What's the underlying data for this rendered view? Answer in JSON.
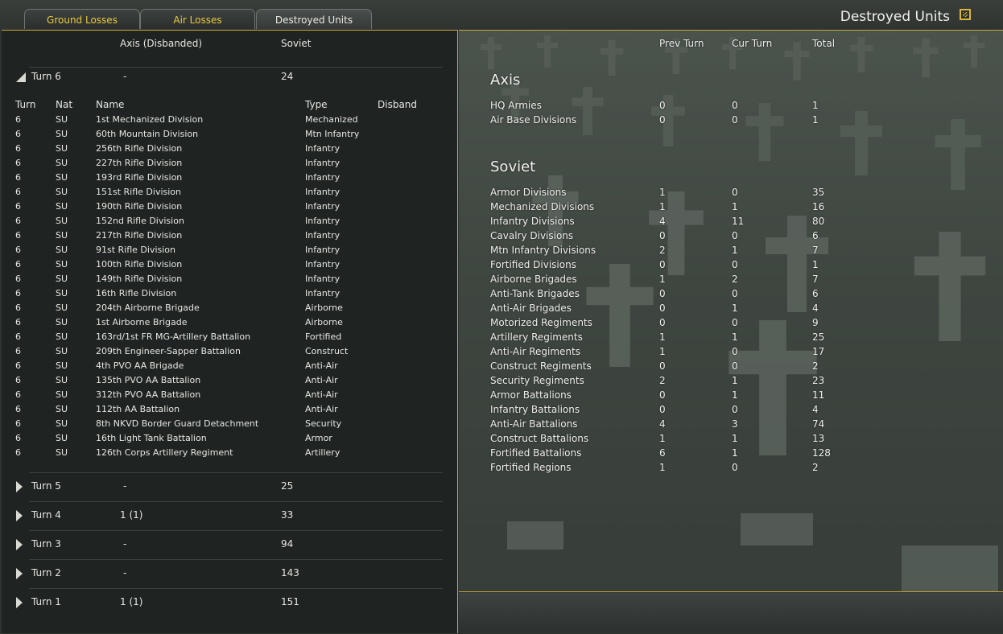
{
  "window": {
    "title": "Destroyed Units"
  },
  "tabs": [
    {
      "label": "Ground Losses",
      "active": false
    },
    {
      "label": "Air Losses",
      "active": false
    },
    {
      "label": "Destroyed Units",
      "active": true
    }
  ],
  "left_panel": {
    "col_axis": "Axis (Disbanded)",
    "col_soviet": "Soviet",
    "expanded_turn": {
      "label": "Turn 6",
      "axis": "-",
      "soviet": "24"
    },
    "unit_headers": {
      "turn": "Turn",
      "nat": "Nat",
      "name": "Name",
      "type": "Type",
      "disband": "Disband"
    },
    "units": [
      {
        "turn": "6",
        "nat": "SU",
        "name": "1st Mechanized Division",
        "type": "Mechanized"
      },
      {
        "turn": "6",
        "nat": "SU",
        "name": "60th Mountain Division",
        "type": "Mtn Infantry"
      },
      {
        "turn": "6",
        "nat": "SU",
        "name": "256th Rifle Division",
        "type": "Infantry"
      },
      {
        "turn": "6",
        "nat": "SU",
        "name": "227th Rifle Division",
        "type": "Infantry"
      },
      {
        "turn": "6",
        "nat": "SU",
        "name": "193rd Rifle Division",
        "type": "Infantry"
      },
      {
        "turn": "6",
        "nat": "SU",
        "name": "151st Rifle Division",
        "type": "Infantry"
      },
      {
        "turn": "6",
        "nat": "SU",
        "name": "190th Rifle Division",
        "type": "Infantry"
      },
      {
        "turn": "6",
        "nat": "SU",
        "name": "152nd Rifle Division",
        "type": "Infantry"
      },
      {
        "turn": "6",
        "nat": "SU",
        "name": "217th Rifle Division",
        "type": "Infantry"
      },
      {
        "turn": "6",
        "nat": "SU",
        "name": "91st Rifle Division",
        "type": "Infantry"
      },
      {
        "turn": "6",
        "nat": "SU",
        "name": "100th Rifle Division",
        "type": "Infantry"
      },
      {
        "turn": "6",
        "nat": "SU",
        "name": "149th Rifle Division",
        "type": "Infantry"
      },
      {
        "turn": "6",
        "nat": "SU",
        "name": "16th Rifle Division",
        "type": "Infantry"
      },
      {
        "turn": "6",
        "nat": "SU",
        "name": "204th Airborne Brigade",
        "type": "Airborne"
      },
      {
        "turn": "6",
        "nat": "SU",
        "name": "1st Airborne Brigade",
        "type": "Airborne"
      },
      {
        "turn": "6",
        "nat": "SU",
        "name": "163rd/1st FR MG-Artillery Battalion",
        "type": "Fortified"
      },
      {
        "turn": "6",
        "nat": "SU",
        "name": "209th Engineer-Sapper Battalion",
        "type": "Construct"
      },
      {
        "turn": "6",
        "nat": "SU",
        "name": "4th PVO AA Brigade",
        "type": "Anti-Air"
      },
      {
        "turn": "6",
        "nat": "SU",
        "name": "135th PVO AA Battalion",
        "type": "Anti-Air"
      },
      {
        "turn": "6",
        "nat": "SU",
        "name": "312th PVO AA Battalion",
        "type": "Anti-Air"
      },
      {
        "turn": "6",
        "nat": "SU",
        "name": "112th AA Battalion",
        "type": "Anti-Air"
      },
      {
        "turn": "6",
        "nat": "SU",
        "name": "8th NKVD Border Guard Detachment",
        "type": "Security"
      },
      {
        "turn": "6",
        "nat": "SU",
        "name": "16th Light Tank Battalion",
        "type": "Armor"
      },
      {
        "turn": "6",
        "nat": "SU",
        "name": "126th Corps Artillery Regiment",
        "type": "Artillery"
      }
    ],
    "collapsed_turns": [
      {
        "label": "Turn 5",
        "axis": "-",
        "soviet": "25"
      },
      {
        "label": "Turn 4",
        "axis": "1 (1)",
        "soviet": "33"
      },
      {
        "label": "Turn 3",
        "axis": "-",
        "soviet": "94"
      },
      {
        "label": "Turn 2",
        "axis": "-",
        "soviet": "143"
      },
      {
        "label": "Turn 1",
        "axis": "1 (1)",
        "soviet": "151"
      }
    ]
  },
  "right_panel": {
    "col_prev": "Prev Turn",
    "col_cur": "Cur Turn",
    "col_total": "Total",
    "axis_title": "Axis",
    "axis_rows": [
      {
        "label": "HQ Armies",
        "prev": "0",
        "cur": "0",
        "total": "1"
      },
      {
        "label": "Air Base Divisions",
        "prev": "0",
        "cur": "0",
        "total": "1"
      }
    ],
    "soviet_title": "Soviet",
    "soviet_rows": [
      {
        "label": "Armor Divisions",
        "prev": "1",
        "cur": "0",
        "total": "35"
      },
      {
        "label": "Mechanized Divisions",
        "prev": "1",
        "cur": "1",
        "total": "16"
      },
      {
        "label": "Infantry Divisions",
        "prev": "4",
        "cur": "11",
        "total": "80"
      },
      {
        "label": "Cavalry Divisions",
        "prev": "0",
        "cur": "0",
        "total": "6"
      },
      {
        "label": "Mtn Infantry Divisions",
        "prev": "2",
        "cur": "1",
        "total": "7"
      },
      {
        "label": "Fortified Divisions",
        "prev": "0",
        "cur": "0",
        "total": "1"
      },
      {
        "label": "Airborne Brigades",
        "prev": "1",
        "cur": "2",
        "total": "7"
      },
      {
        "label": "Anti-Tank Brigades",
        "prev": "0",
        "cur": "0",
        "total": "6"
      },
      {
        "label": "Anti-Air Brigades",
        "prev": "0",
        "cur": "1",
        "total": "4"
      },
      {
        "label": "Motorized Regiments",
        "prev": "0",
        "cur": "0",
        "total": "9"
      },
      {
        "label": "Artillery Regiments",
        "prev": "1",
        "cur": "1",
        "total": "25"
      },
      {
        "label": "Anti-Air Regiments",
        "prev": "1",
        "cur": "0",
        "total": "17"
      },
      {
        "label": "Construct Regiments",
        "prev": "0",
        "cur": "0",
        "total": "2"
      },
      {
        "label": "Security Regiments",
        "prev": "2",
        "cur": "1",
        "total": "23"
      },
      {
        "label": "Armor Battalions",
        "prev": "0",
        "cur": "1",
        "total": "11"
      },
      {
        "label": "Infantry Battalions",
        "prev": "0",
        "cur": "0",
        "total": "4"
      },
      {
        "label": "Anti-Air Battalions",
        "prev": "4",
        "cur": "3",
        "total": "74"
      },
      {
        "label": "Construct Battalions",
        "prev": "1",
        "cur": "1",
        "total": "13"
      },
      {
        "label": "Fortified Battalions",
        "prev": "6",
        "cur": "1",
        "total": "128"
      },
      {
        "label": "Fortified Regions",
        "prev": "1",
        "cur": "0",
        "total": "2"
      }
    ]
  },
  "colors": {
    "accent_gold": "#caa63a",
    "tab_inactive_text": "#e8c83e",
    "panel_bg": "#1f2321"
  }
}
